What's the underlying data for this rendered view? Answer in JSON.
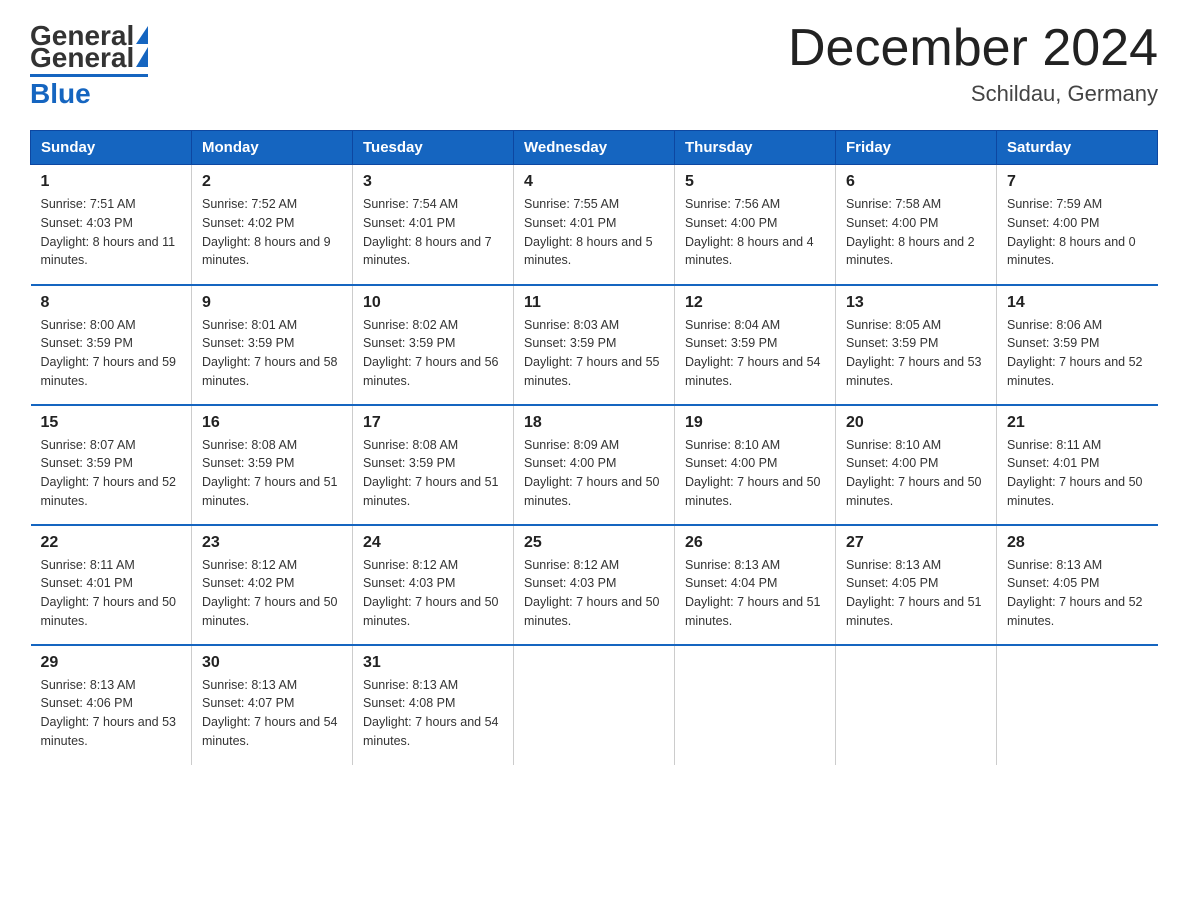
{
  "header": {
    "title": "December 2024",
    "location": "Schildau, Germany",
    "logo_general": "General",
    "logo_blue": "Blue"
  },
  "weekdays": [
    "Sunday",
    "Monday",
    "Tuesday",
    "Wednesday",
    "Thursday",
    "Friday",
    "Saturday"
  ],
  "weeks": [
    [
      {
        "day": "1",
        "sunrise": "7:51 AM",
        "sunset": "4:03 PM",
        "daylight": "8 hours and 11 minutes."
      },
      {
        "day": "2",
        "sunrise": "7:52 AM",
        "sunset": "4:02 PM",
        "daylight": "8 hours and 9 minutes."
      },
      {
        "day": "3",
        "sunrise": "7:54 AM",
        "sunset": "4:01 PM",
        "daylight": "8 hours and 7 minutes."
      },
      {
        "day": "4",
        "sunrise": "7:55 AM",
        "sunset": "4:01 PM",
        "daylight": "8 hours and 5 minutes."
      },
      {
        "day": "5",
        "sunrise": "7:56 AM",
        "sunset": "4:00 PM",
        "daylight": "8 hours and 4 minutes."
      },
      {
        "day": "6",
        "sunrise": "7:58 AM",
        "sunset": "4:00 PM",
        "daylight": "8 hours and 2 minutes."
      },
      {
        "day": "7",
        "sunrise": "7:59 AM",
        "sunset": "4:00 PM",
        "daylight": "8 hours and 0 minutes."
      }
    ],
    [
      {
        "day": "8",
        "sunrise": "8:00 AM",
        "sunset": "3:59 PM",
        "daylight": "7 hours and 59 minutes."
      },
      {
        "day": "9",
        "sunrise": "8:01 AM",
        "sunset": "3:59 PM",
        "daylight": "7 hours and 58 minutes."
      },
      {
        "day": "10",
        "sunrise": "8:02 AM",
        "sunset": "3:59 PM",
        "daylight": "7 hours and 56 minutes."
      },
      {
        "day": "11",
        "sunrise": "8:03 AM",
        "sunset": "3:59 PM",
        "daylight": "7 hours and 55 minutes."
      },
      {
        "day": "12",
        "sunrise": "8:04 AM",
        "sunset": "3:59 PM",
        "daylight": "7 hours and 54 minutes."
      },
      {
        "day": "13",
        "sunrise": "8:05 AM",
        "sunset": "3:59 PM",
        "daylight": "7 hours and 53 minutes."
      },
      {
        "day": "14",
        "sunrise": "8:06 AM",
        "sunset": "3:59 PM",
        "daylight": "7 hours and 52 minutes."
      }
    ],
    [
      {
        "day": "15",
        "sunrise": "8:07 AM",
        "sunset": "3:59 PM",
        "daylight": "7 hours and 52 minutes."
      },
      {
        "day": "16",
        "sunrise": "8:08 AM",
        "sunset": "3:59 PM",
        "daylight": "7 hours and 51 minutes."
      },
      {
        "day": "17",
        "sunrise": "8:08 AM",
        "sunset": "3:59 PM",
        "daylight": "7 hours and 51 minutes."
      },
      {
        "day": "18",
        "sunrise": "8:09 AM",
        "sunset": "4:00 PM",
        "daylight": "7 hours and 50 minutes."
      },
      {
        "day": "19",
        "sunrise": "8:10 AM",
        "sunset": "4:00 PM",
        "daylight": "7 hours and 50 minutes."
      },
      {
        "day": "20",
        "sunrise": "8:10 AM",
        "sunset": "4:00 PM",
        "daylight": "7 hours and 50 minutes."
      },
      {
        "day": "21",
        "sunrise": "8:11 AM",
        "sunset": "4:01 PM",
        "daylight": "7 hours and 50 minutes."
      }
    ],
    [
      {
        "day": "22",
        "sunrise": "8:11 AM",
        "sunset": "4:01 PM",
        "daylight": "7 hours and 50 minutes."
      },
      {
        "day": "23",
        "sunrise": "8:12 AM",
        "sunset": "4:02 PM",
        "daylight": "7 hours and 50 minutes."
      },
      {
        "day": "24",
        "sunrise": "8:12 AM",
        "sunset": "4:03 PM",
        "daylight": "7 hours and 50 minutes."
      },
      {
        "day": "25",
        "sunrise": "8:12 AM",
        "sunset": "4:03 PM",
        "daylight": "7 hours and 50 minutes."
      },
      {
        "day": "26",
        "sunrise": "8:13 AM",
        "sunset": "4:04 PM",
        "daylight": "7 hours and 51 minutes."
      },
      {
        "day": "27",
        "sunrise": "8:13 AM",
        "sunset": "4:05 PM",
        "daylight": "7 hours and 51 minutes."
      },
      {
        "day": "28",
        "sunrise": "8:13 AM",
        "sunset": "4:05 PM",
        "daylight": "7 hours and 52 minutes."
      }
    ],
    [
      {
        "day": "29",
        "sunrise": "8:13 AM",
        "sunset": "4:06 PM",
        "daylight": "7 hours and 53 minutes."
      },
      {
        "day": "30",
        "sunrise": "8:13 AM",
        "sunset": "4:07 PM",
        "daylight": "7 hours and 54 minutes."
      },
      {
        "day": "31",
        "sunrise": "8:13 AM",
        "sunset": "4:08 PM",
        "daylight": "7 hours and 54 minutes."
      },
      null,
      null,
      null,
      null
    ]
  ]
}
